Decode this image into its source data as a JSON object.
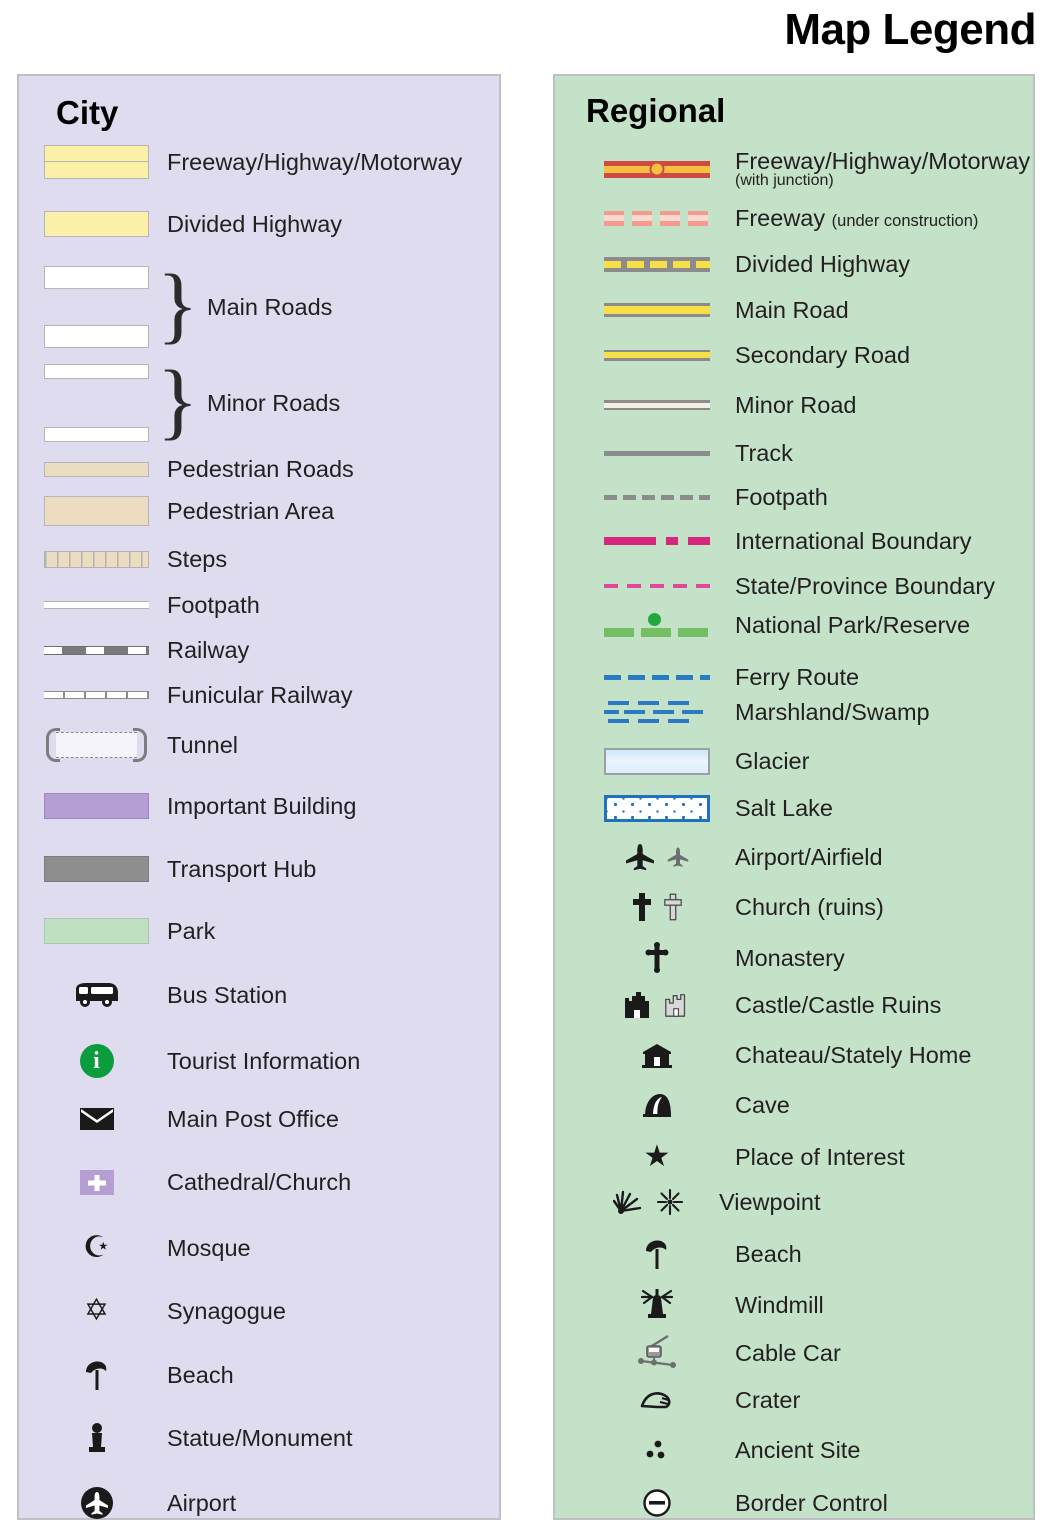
{
  "title": "Map Legend",
  "city": {
    "heading": "City",
    "items": [
      {
        "label": "Freeway/Highway/Motorway",
        "symbol": "freeway-double-band",
        "color": "#faf0a8"
      },
      {
        "label": "Divided Highway",
        "symbol": "yellow-band",
        "color": "#faf0a8"
      },
      {
        "label": "Main Roads",
        "symbol": "two-white-thick-bands-braced",
        "color": "#ffffff"
      },
      {
        "label": "Minor Roads",
        "symbol": "two-white-thin-bands-braced",
        "color": "#ffffff"
      },
      {
        "label": "Pedestrian Roads",
        "symbol": "tan-thin-band",
        "color": "#ecdcc2"
      },
      {
        "label": "Pedestrian Area",
        "symbol": "tan-block",
        "color": "#ecdcc2"
      },
      {
        "label": "Steps",
        "symbol": "hatched-tan-band",
        "color": "#ecdcc2"
      },
      {
        "label": "Footpath",
        "symbol": "thin-white-line",
        "color": "#ffffff"
      },
      {
        "label": "Railway",
        "symbol": "dashed-grey-railway-line",
        "color": "#7a7a7a"
      },
      {
        "label": "Funicular Railway",
        "symbol": "ticked-line",
        "color": "#8c8c8c"
      },
      {
        "label": "Tunnel",
        "symbol": "dashed-tunnel-with-brackets",
        "color": "#8a8a8a"
      },
      {
        "label": "Important Building",
        "symbol": "purple-block",
        "color": "#b59ed4"
      },
      {
        "label": "Transport Hub",
        "symbol": "grey-block",
        "color": "#8e8e8e"
      },
      {
        "label": "Park",
        "symbol": "green-block",
        "color": "#bfe0c2"
      },
      {
        "label": "Bus Station",
        "symbol": "bus-icon",
        "color": "#1a1a1a"
      },
      {
        "label": "Tourist Information",
        "symbol": "information-circle-icon",
        "color": "#0a9c3d"
      },
      {
        "label": "Main Post Office",
        "symbol": "envelope-icon",
        "color": "#1a1a1a"
      },
      {
        "label": "Cathedral/Church",
        "symbol": "cross-on-purple-square-icon",
        "color": "#b59ed4"
      },
      {
        "label": "Mosque",
        "symbol": "star-and-crescent-icon",
        "color": "#1a1a1a"
      },
      {
        "label": "Synagogue",
        "symbol": "star-of-david-icon",
        "color": "#1a1a1a"
      },
      {
        "label": "Beach",
        "symbol": "parasol-icon",
        "color": "#1a1a1a"
      },
      {
        "label": "Statue/Monument",
        "symbol": "statue-icon",
        "color": "#1a1a1a"
      },
      {
        "label": "Airport",
        "symbol": "airplane-circle-icon",
        "color": "#1a1a1a"
      }
    ]
  },
  "regional": {
    "heading": "Regional",
    "items": [
      {
        "label": "Freeway/Highway/Motorway",
        "sublabel": "(with junction)",
        "symbol": "red-freeway-with-junction",
        "color": "#cf4a43"
      },
      {
        "label": "Freeway",
        "inline_sublabel": "(under construction)",
        "symbol": "dashed-pink-freeway",
        "color": "#f59a8e"
      },
      {
        "label": "Divided Highway",
        "symbol": "grey-yellow-dashed-band",
        "color": "#f7e047"
      },
      {
        "label": "Main Road",
        "symbol": "yellow-band-grey-casing",
        "color": "#f7e047"
      },
      {
        "label": "Secondary Road",
        "symbol": "thin-yellow-band-grey-casing",
        "color": "#f7e047"
      },
      {
        "label": "Minor Road",
        "symbol": "cream-band-grey-casing",
        "color": "#f2efe4"
      },
      {
        "label": "Track",
        "symbol": "solid-grey-line",
        "color": "#8c8c8c"
      },
      {
        "label": "Footpath",
        "symbol": "dashed-grey-line",
        "color": "#8c8c8c"
      },
      {
        "label": "International Boundary",
        "symbol": "magenta-dash-dot-line",
        "color": "#d4277e"
      },
      {
        "label": "State/Province Boundary",
        "symbol": "pink-dashed-line",
        "color": "#e0479a"
      },
      {
        "label": "National Park/Reserve",
        "symbol": "green-dashed-line-with-dot",
        "color": "#74bf62"
      },
      {
        "label": "Ferry Route",
        "symbol": "blue-dashed-line",
        "color": "#2b7bc4"
      },
      {
        "label": "Marshland/Swamp",
        "symbol": "blue-dash-pattern",
        "color": "#2b7bc4"
      },
      {
        "label": "Glacier",
        "symbol": "pale-blue-gradient-block",
        "color": "#cfe7f7"
      },
      {
        "label": "Salt Lake",
        "symbol": "blue-speckled-block",
        "color": "#1f72c0"
      },
      {
        "label": "Airport/Airfield",
        "symbol": "airplane-pair-icon",
        "color": "#1a1a1a"
      },
      {
        "label": "Church (ruins)",
        "symbol": "cross-pair-icon",
        "color": "#1a1a1a"
      },
      {
        "label": "Monastery",
        "symbol": "orthodox-cross-icon",
        "color": "#1a1a1a"
      },
      {
        "label": "Castle/Castle Ruins",
        "symbol": "castle-pair-icon",
        "color": "#1a1a1a"
      },
      {
        "label": "Chateau/Stately Home",
        "symbol": "chateau-icon",
        "color": "#1a1a1a"
      },
      {
        "label": "Cave",
        "symbol": "cave-icon",
        "color": "#1a1a1a"
      },
      {
        "label": "Place of Interest",
        "symbol": "star-icon",
        "color": "#1a1a1a"
      },
      {
        "label": "Viewpoint",
        "symbol": "viewpoint-pair-icon",
        "color": "#1a1a1a"
      },
      {
        "label": "Beach",
        "symbol": "parasol-icon",
        "color": "#1a1a1a"
      },
      {
        "label": "Windmill",
        "symbol": "windmill-icon",
        "color": "#1a1a1a"
      },
      {
        "label": "Cable Car",
        "symbol": "cable-car-icon",
        "color": "#6e6e6e"
      },
      {
        "label": "Crater",
        "symbol": "crater-icon",
        "color": "#1a1a1a"
      },
      {
        "label": "Ancient Site",
        "symbol": "three-dots-icon",
        "color": "#1a1a1a"
      },
      {
        "label": "Border Control",
        "symbol": "minus-circle-icon",
        "color": "#1a1a1a"
      }
    ]
  },
  "colors": {
    "city_panel_bg": "#dedcee",
    "regional_panel_bg": "#c4e2c8",
    "panel_border": "#bfbfc4",
    "text": "#231f20"
  }
}
